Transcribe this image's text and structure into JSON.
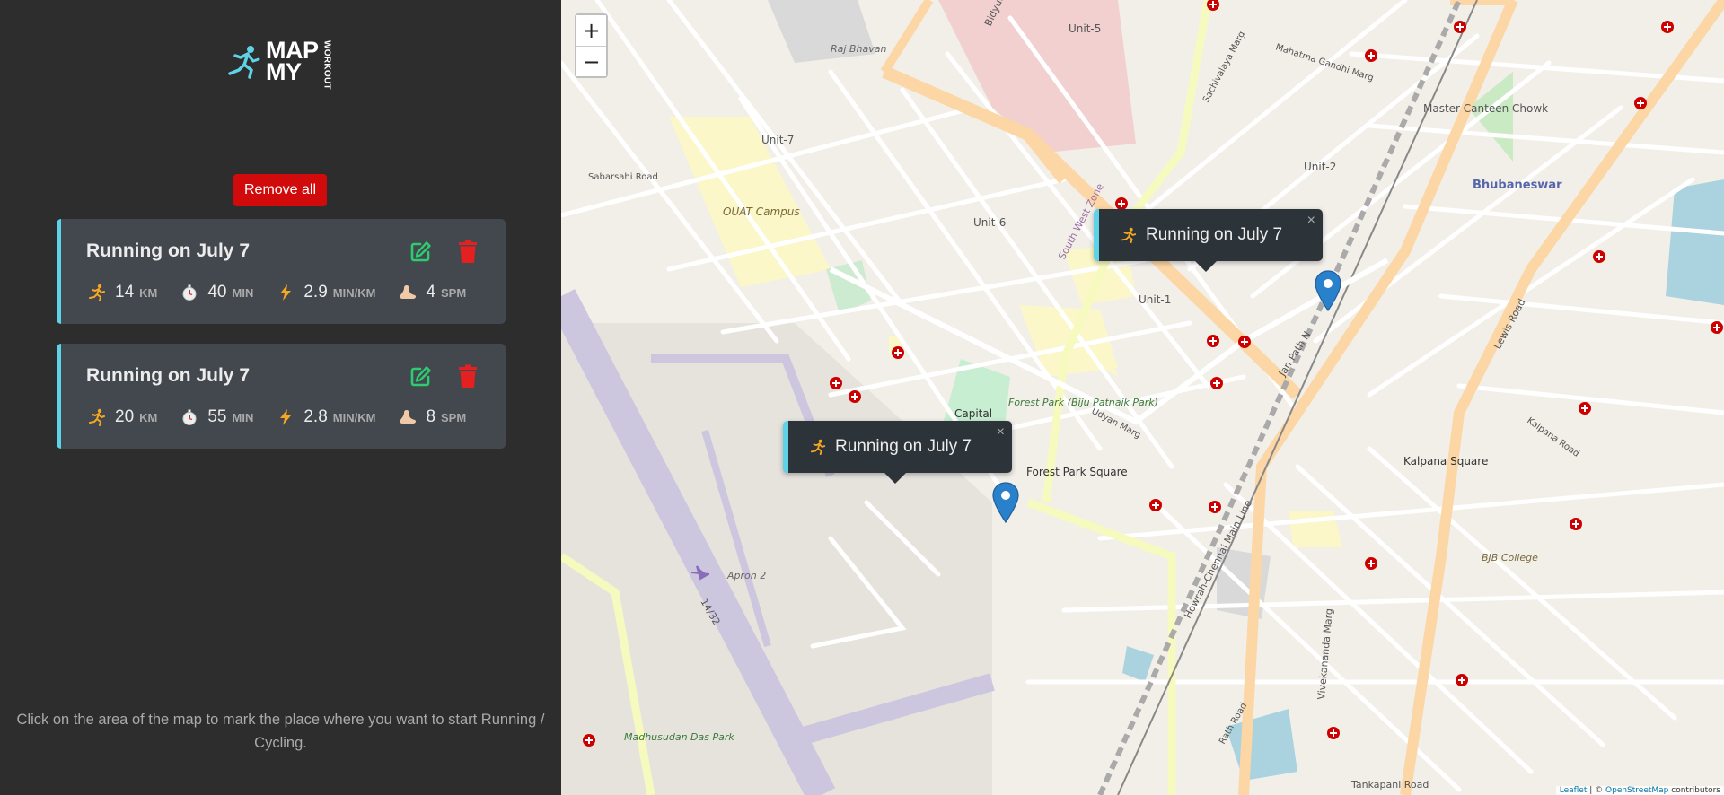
{
  "app": {
    "logo_line1": "MAP",
    "logo_line2": "MY",
    "logo_side": "WORKOUT",
    "accent_color": "#5ed2e6",
    "danger_color": "#d10b0b",
    "edit_color": "#2ecc71"
  },
  "sidebar": {
    "remove_all_label": "Remove all",
    "hint": "Click on the area of the map to mark the place where you want to start Running / Cycling."
  },
  "workouts": [
    {
      "title": "Running on July 7",
      "distance": "14",
      "distance_unit": "KM",
      "duration": "40",
      "duration_unit": "MIN",
      "pace": "2.9",
      "pace_unit": "MIN/KM",
      "cadence": "4",
      "cadence_unit": "SPM"
    },
    {
      "title": "Running on July 7",
      "distance": "20",
      "distance_unit": "KM",
      "duration": "55",
      "duration_unit": "MIN",
      "pace": "2.8",
      "pace_unit": "MIN/KM",
      "cadence": "8",
      "cadence_unit": "SPM"
    }
  ],
  "map": {
    "zoom_in": "+",
    "zoom_out": "−",
    "popups": [
      {
        "label": "Running on July 7",
        "close": "×"
      },
      {
        "label": "Running on July 7",
        "close": "×"
      }
    ],
    "labels": {
      "raj_bhavan": "Raj Bhavan",
      "unit5": "Unit-5",
      "unit7": "Unit-7",
      "unit6": "Unit-6",
      "unit1": "Unit-1",
      "unit2": "Unit-2",
      "sabarsahi": "Sabarsahi Road",
      "ouat": "OUAT Campus",
      "south_west_zone": "South West Zone",
      "mg_marg": "Mahatma Gandhi Marg",
      "sachivalaya": "Sachivalaya Marg",
      "master_canteen": "Master Canteen Chowk",
      "bhubaneswar": "Bhubaneswar",
      "capital": "Capital",
      "forest_park": "Forest Park (Biju Patnaik Park)",
      "forest_park_square": "Forest Park Square",
      "udyan_marg": "Udyan Marg",
      "janpath": "Jan Path N",
      "kalpana_square": "Kalpana Square",
      "kalpana_road": "Kalpana Road",
      "lewis_road": "Lewis Road",
      "bjb": "BJB College",
      "apron": "Apron 2",
      "runway": "14/32",
      "vivekananda": "Vivekananda Marg",
      "rath_road": "Rath Road",
      "tankapani": "Tankapani Road",
      "madhusudan": "Madhusudan Das Park",
      "howrah": "Howrah-Chennai Main Line",
      "bidyut": "Bidyut"
    },
    "attribution_leaflet": "Leaflet",
    "attribution_sep": " | © ",
    "attribution_osm": "OpenStreetMap",
    "attribution_rest": " contributors"
  }
}
